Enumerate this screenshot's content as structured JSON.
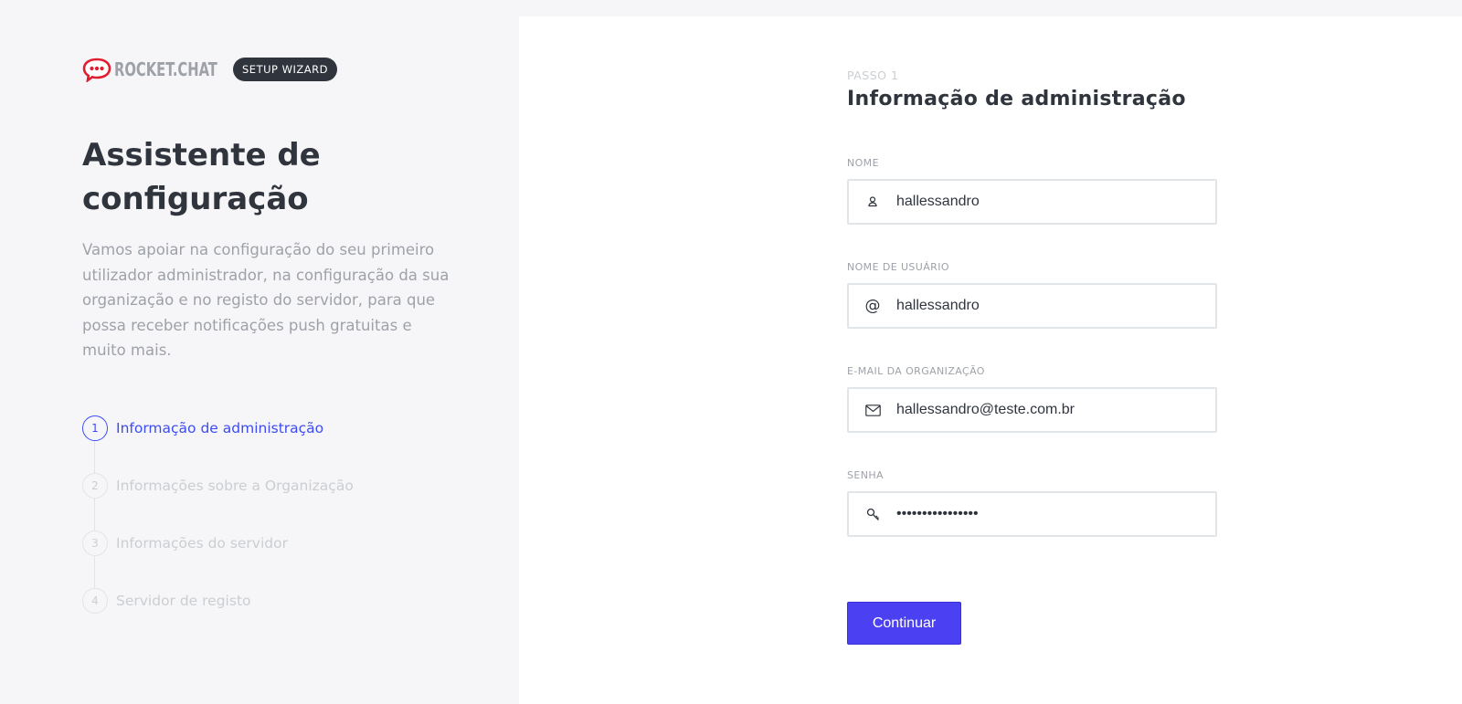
{
  "brand": {
    "name": "ROCKET.CHAT",
    "badge": "SETUP WIZARD",
    "logo_icon": "rocketchat-logo-icon",
    "accent_color": "#e01e2f"
  },
  "intro": {
    "title": "Assistente de configuração",
    "description": "Vamos apoiar na configuração do seu primeiro utilizador administrador, na configuração da sua organização e no registo do servidor, para que possa receber notificações push gratuitas e muito mais."
  },
  "steps": [
    {
      "number": "1",
      "label": "Informação de administração",
      "active": true
    },
    {
      "number": "2",
      "label": "Informações sobre a Organização",
      "active": false
    },
    {
      "number": "3",
      "label": "Informações do servidor",
      "active": false
    },
    {
      "number": "4",
      "label": "Servidor de registo",
      "active": false
    }
  ],
  "form": {
    "kicker": "PASSO 1",
    "title": "Informação de administração",
    "fields": {
      "name": {
        "label": "NOME",
        "value": "hallessandro",
        "icon": "user-icon"
      },
      "username": {
        "label": "NOME DE USUÁRIO",
        "value": "hallessandro",
        "icon": "at-icon"
      },
      "email": {
        "label": "E-MAIL DA ORGANIZAÇÃO",
        "value": "hallessandro@teste.com.br",
        "icon": "mail-icon"
      },
      "password": {
        "label": "SENHA",
        "value": "hallessandro1234",
        "icon": "key-icon"
      }
    },
    "submit_label": "Continuar"
  },
  "colors": {
    "primary": "#4b40f2",
    "active_step": "#3d4cf0",
    "muted": "#cbced1"
  }
}
